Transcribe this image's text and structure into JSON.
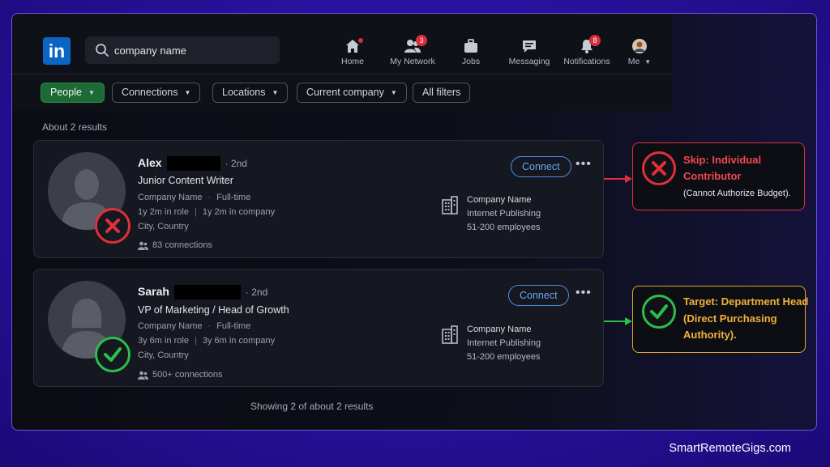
{
  "search": {
    "value": "company name",
    "placeholder": "Search"
  },
  "nav": {
    "home": "Home",
    "my_network": "My Network",
    "my_network_badge": "3",
    "jobs": "Jobs",
    "messaging": "Messaging",
    "notifications": "Notifications",
    "notifications_badge": "8",
    "me": "Me"
  },
  "filters": [
    "People",
    "Connections",
    "Locations",
    "Current company",
    "All filters"
  ],
  "results_count": "About 2 results",
  "results": [
    {
      "name": "Alex",
      "degree": "· 2nd",
      "title": "Junior Content Writer",
      "company_line": "Company Name",
      "employment": "Full-time",
      "role_tenure": "1y 2m in role",
      "company_tenure": "1y 2m in company",
      "location": "City, Country",
      "connections": "83 connections",
      "company_name": "Company Name",
      "industry": "Internet Publishing",
      "size": "51-200 employees",
      "connect": "Connect",
      "status": "reject"
    },
    {
      "name": "Sarah",
      "degree": "· 2nd",
      "title": "VP of Marketing / Head of Growth",
      "company_line": "Company Name",
      "employment": "Full-time",
      "role_tenure": "3y 6m in role",
      "company_tenure": "3y 6m in company",
      "location": "City, Country",
      "connections": "500+ connections",
      "company_name": "Company Name",
      "industry": "Internet Publishing",
      "size": "51-200 employees",
      "connect": "Connect",
      "status": "accept"
    }
  ],
  "showing": "Showing 2 of about 2 results",
  "annotations": {
    "skip": {
      "line1": "Skip: Individual",
      "line2": "Contributor",
      "line3": "(Cannot Authorize Budget).",
      "color": "#e0303a"
    },
    "target": {
      "line1": "Target: Department Head",
      "line2": "(Direct Purchasing",
      "line3": "Authority).",
      "color": "#e3a62a"
    }
  },
  "watermark": "SmartRemoteGigs.com",
  "colors": {
    "linkedin_blue": "#0a66c2",
    "active_filter": "#1d6a36",
    "reject": "#e0303a",
    "accept": "#2bbf4a"
  }
}
